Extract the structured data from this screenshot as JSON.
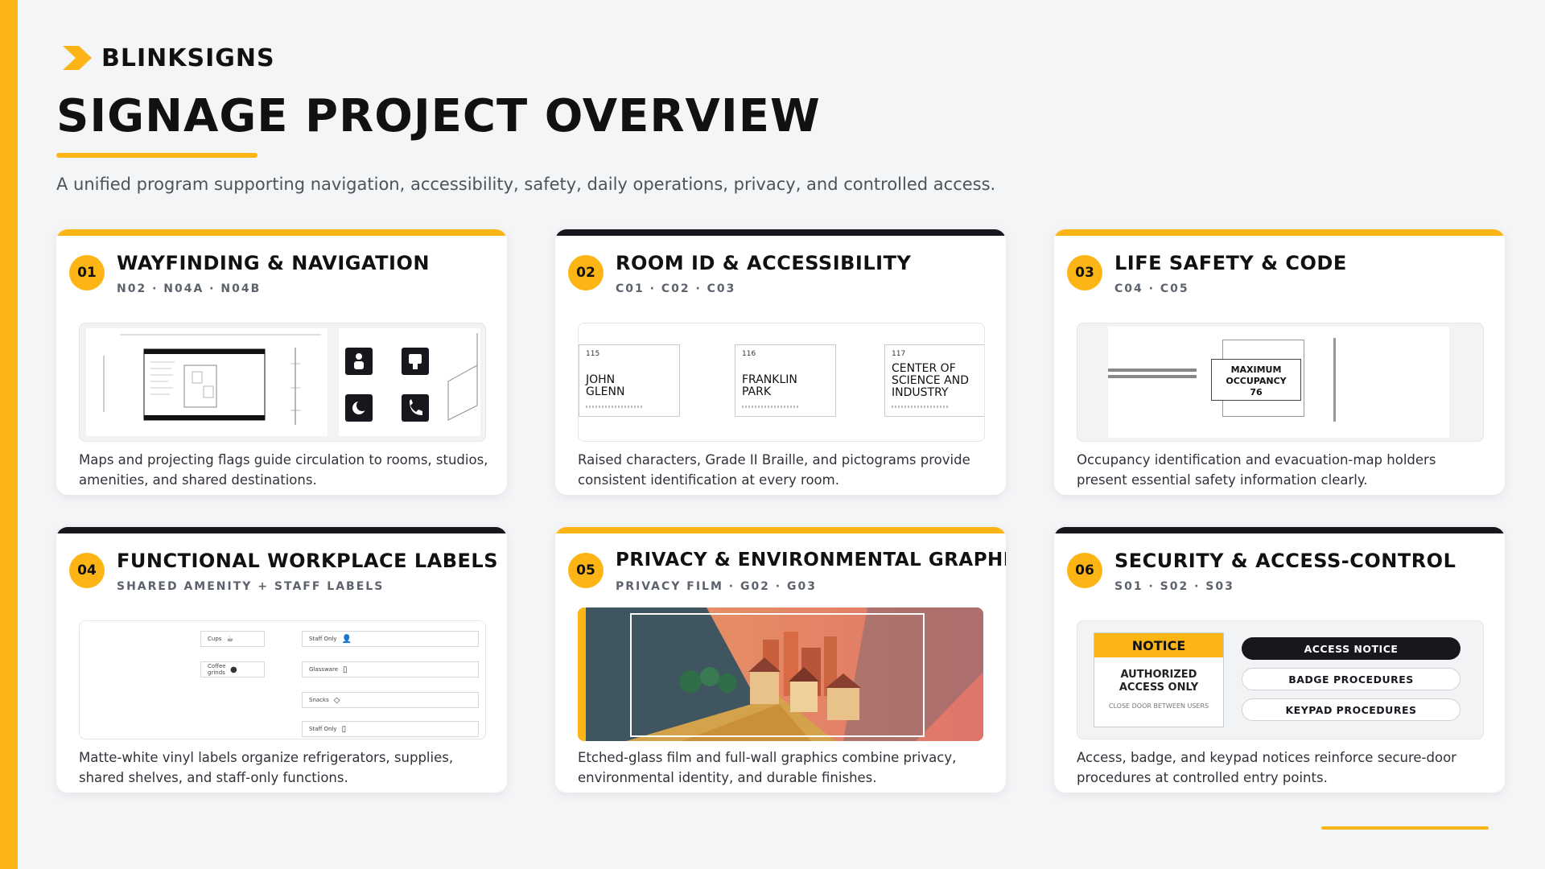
{
  "brand": {
    "name": "BLINKSIGNS",
    "accent": "#fdb515",
    "dark": "#16181d"
  },
  "page": {
    "title": "SIGNAGE PROJECT OVERVIEW",
    "subtitle": "A unified program supporting navigation, accessibility, safety, daily operations, privacy, and controlled access."
  },
  "cards": [
    {
      "number": "01",
      "title": "WAYFINDING & NAVIGATION",
      "codes": "N02 · N04A · N04B",
      "description": "Maps and projecting flags guide circulation to rooms, studios, amenities, and shared destinations.",
      "accent": "yellow"
    },
    {
      "number": "02",
      "title": "ROOM ID & ACCESSIBILITY",
      "codes": "C01 · C02 · C03",
      "description": "Raised characters, Grade II Braille, and pictograms provide consistent identification at every room.",
      "accent": "dark",
      "room_signs": [
        {
          "number": "115",
          "name": "JOHN GLENN"
        },
        {
          "number": "116",
          "name": "FRANKLIN PARK"
        },
        {
          "number": "117",
          "name": "CENTER OF SCIENCE AND INDUSTRY"
        }
      ]
    },
    {
      "number": "03",
      "title": "LIFE SAFETY & CODE",
      "codes": "C04 · C05",
      "description": "Occupancy identification and evacuation-map holders present essential safety information clearly.",
      "accent": "yellow",
      "occupancy": {
        "label": "MAXIMUM OCCUPANCY",
        "value": "76"
      }
    },
    {
      "number": "04",
      "title": "FUNCTIONAL WORKPLACE LABELS",
      "codes": "SHARED AMENITY + STAFF LABELS",
      "description": "Matte-white vinyl labels organize refrigerators, supplies, shared shelves, and staff-only functions.",
      "accent": "dark",
      "labels": [
        "Cups",
        "Coffee grinds",
        "Staff Only",
        "Glassware",
        "Snacks",
        "Staff Only"
      ]
    },
    {
      "number": "05",
      "title": "PRIVACY & ENVIRONMENTAL GRAPHICS",
      "codes": "PRIVACY FILM · G02 · G03",
      "description": "Etched-glass film and full-wall graphics combine privacy, environmental identity, and durable finishes.",
      "accent": "yellow"
    },
    {
      "number": "06",
      "title": "SECURITY & ACCESS-CONTROL",
      "codes": "S01 · S02 · S03",
      "description": "Access, badge, and keypad notices reinforce secure-door procedures at controlled entry points.",
      "accent": "dark",
      "notice": {
        "head": "NOTICE",
        "body": "AUTHORIZED ACCESS ONLY",
        "fine": "CLOSE DOOR BETWEEN USERS"
      },
      "access_items": [
        "ACCESS NOTICE",
        "BADGE PROCEDURES",
        "KEYPAD PROCEDURES"
      ]
    }
  ]
}
